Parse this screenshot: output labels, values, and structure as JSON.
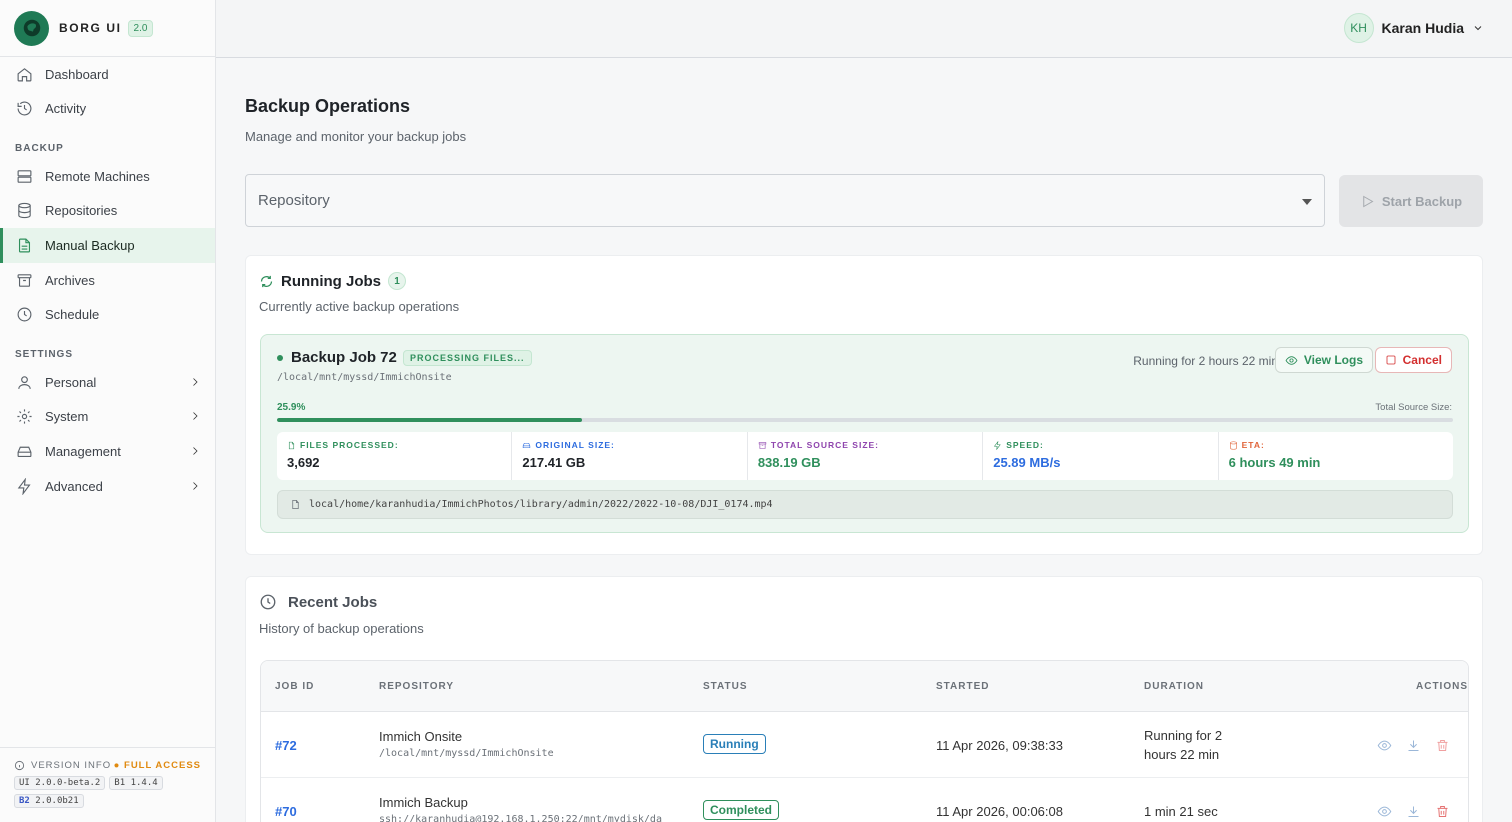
{
  "brand": {
    "name": "BORG UI",
    "version": "2.0"
  },
  "sidebar": {
    "top_items": [
      {
        "label": "Dashboard",
        "icon": "home-icon"
      },
      {
        "label": "Activity",
        "icon": "history-icon"
      }
    ],
    "backup_section": "BACKUP",
    "backup_items": [
      {
        "label": "Remote Machines",
        "icon": "server-icon"
      },
      {
        "label": "Repositories",
        "icon": "database-icon"
      },
      {
        "label": "Manual Backup",
        "icon": "file-icon",
        "active": true
      },
      {
        "label": "Archives",
        "icon": "archive-icon"
      },
      {
        "label": "Schedule",
        "icon": "clock-icon"
      }
    ],
    "settings_section": "SETTINGS",
    "settings_items": [
      {
        "label": "Personal",
        "icon": "user-icon"
      },
      {
        "label": "System",
        "icon": "gear-icon"
      },
      {
        "label": "Management",
        "icon": "drive-icon"
      },
      {
        "label": "Advanced",
        "icon": "bolt-icon"
      }
    ],
    "version_info": {
      "label": "VERSION INFO",
      "access": "FULL ACCESS",
      "ui_prefix": "UI",
      "ui": "2.0.0-beta.2",
      "b1_prefix": "B1",
      "b1": "1.4.4",
      "b2_prefix": "B2",
      "b2": "2.0.0b21"
    }
  },
  "header": {
    "user_initials": "KH",
    "user_name": "Karan Hudia"
  },
  "main": {
    "title": "Backup Operations",
    "subtitle": "Manage and monitor your backup jobs",
    "repo_placeholder": "Repository",
    "start_button": "Start Backup"
  },
  "running_jobs": {
    "title": "Running Jobs",
    "count": "1",
    "subtitle": "Currently active backup operations",
    "job": {
      "title": "Backup Job 72",
      "status_badge": "PROCESSING FILES...",
      "path": "/local/mnt/myssd/ImmichOnsite",
      "running_for": "Running for 2 hours 22 min",
      "view_logs": "View Logs",
      "cancel": "Cancel",
      "progress_label": "25.9%",
      "progress_value": 25.9,
      "total_source_label": "Total Source Size:",
      "stats": [
        {
          "label": "FILES PROCESSED:",
          "value": "3,692",
          "color": "#2f8f5c",
          "value_color": "#1f2328",
          "icon": "file-icon"
        },
        {
          "label": "ORIGINAL SIZE:",
          "value": "217.41 GB",
          "color": "#2d6cdf",
          "value_color": "#1f2328",
          "icon": "drive-icon"
        },
        {
          "label": "TOTAL SOURCE SIZE:",
          "value": "838.19 GB",
          "color": "#8e44ad",
          "value_color": "#2f8f5c",
          "icon": "archive-icon"
        },
        {
          "label": "SPEED:",
          "value": "25.89 MB/s",
          "color": "#2f8f5c",
          "value_color": "#2d6cdf",
          "icon": "bolt-icon"
        },
        {
          "label": "ETA:",
          "value": "6 hours 49 min",
          "color": "#e0643a",
          "value_color": "#2f8f5c",
          "icon": "database-icon"
        }
      ],
      "current_file": "local/home/karanhudia/ImmichPhotos/library/admin/2022/2022-10-08/DJI_0174.mp4"
    }
  },
  "recent_jobs": {
    "title": "Recent Jobs",
    "subtitle": "History of backup operations",
    "columns": [
      "JOB ID",
      "REPOSITORY",
      "STATUS",
      "STARTED",
      "DURATION",
      "ACTIONS"
    ],
    "rows": [
      {
        "id": "#72",
        "repo_name": "Immich Onsite",
        "repo_path": "/local/mnt/myssd/ImmichOnsite",
        "status": "Running",
        "status_color": "#2a7fb8",
        "started": "11 Apr 2026, 09:38:33",
        "duration_line1": "Running for 2",
        "duration_line2": "hours 22 min"
      },
      {
        "id": "#70",
        "repo_name": "Immich Backup",
        "repo_path": "ssh://karanhudia@192.168.1.250:22/mnt/mydisk/da",
        "status": "Completed",
        "status_color": "#2f8f5c",
        "started": "11 Apr 2026, 00:06:08",
        "duration_line1": "1 min 21 sec",
        "duration_line2": ""
      }
    ]
  }
}
